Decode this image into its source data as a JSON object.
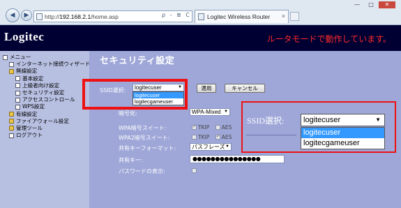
{
  "browser": {
    "url_prefix": "http://",
    "url_host": "192.168.2.1",
    "url_path": "/home.asp",
    "addr_tools": "ρ - ≣ C ×",
    "tab_title": "Logitec Wireless Router",
    "tab_close": "×",
    "window_buttons": {
      "minimize": "—",
      "maximize": "□",
      "close": "✕"
    }
  },
  "header": {
    "logo": "Logitec",
    "mode_text": "ルータモードで動作しています。"
  },
  "sidebar": {
    "items": [
      {
        "label": "メニュー",
        "level": 1,
        "icon": "page"
      },
      {
        "label": "インターネット接続ウィザード",
        "level": 2,
        "icon": "page"
      },
      {
        "label": "無線設定",
        "level": 2,
        "icon": "folder"
      },
      {
        "label": "基本設定",
        "level": 3,
        "icon": "page"
      },
      {
        "label": "上級者向け設定",
        "level": 3,
        "icon": "page"
      },
      {
        "label": "セキュリティ設定",
        "level": 3,
        "icon": "page"
      },
      {
        "label": "アクセスコントロール",
        "level": 3,
        "icon": "page"
      },
      {
        "label": "WPS設定",
        "level": 3,
        "icon": "page"
      },
      {
        "label": "有線設定",
        "level": 2,
        "icon": "folder"
      },
      {
        "label": "ファイアウォール設定",
        "level": 2,
        "icon": "folder"
      },
      {
        "label": "管理ツール",
        "level": 2,
        "icon": "folder"
      },
      {
        "label": "ログアウト",
        "level": 2,
        "icon": "page"
      }
    ]
  },
  "security": {
    "title": "セキュリティ設定",
    "ssid_label": "SSID選択:",
    "ssid_value": "logitecuser",
    "ssid_options": [
      "logitecuser",
      "logitecgameuser"
    ],
    "apply_button": "適用",
    "cancel_button": "キャンセル",
    "encryption_label": "暗号化:",
    "encryption_value": "WPA-Mixed",
    "wpa_suite_label": "WPA暗号スイート:",
    "wpa2_suite_label": "WPA2暗号スイート:",
    "tkip_label": "TKIP",
    "aes_label": "AES",
    "key_format_label": "共有キーフォーマット:",
    "key_format_value": "パスフレーズ",
    "shared_key_label": "共有キー:",
    "shared_key_value": "●●●●●●●●●●●●●●●",
    "show_password_label": "パスワードの表示:"
  },
  "callout": {
    "ssid_label": "SSID選択:",
    "ssid_value": "logitecuser",
    "options": [
      "logitecuser",
      "logitecgameuser"
    ]
  }
}
